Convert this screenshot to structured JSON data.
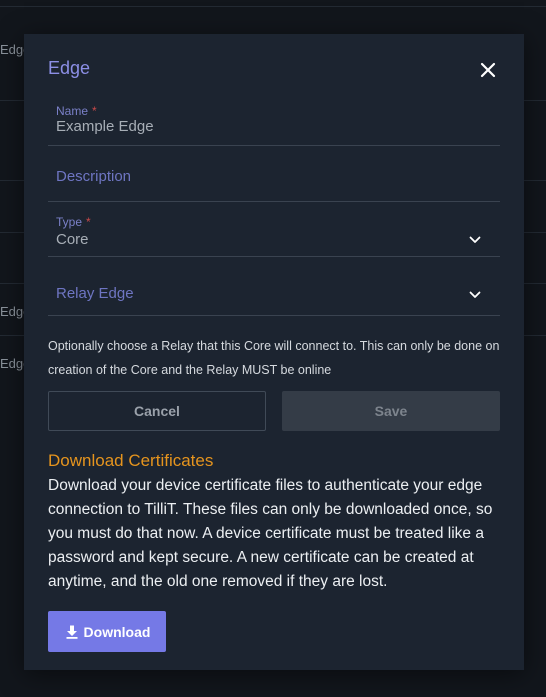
{
  "background": {
    "row_labels": [
      "Edge",
      "Edge",
      "Edge"
    ]
  },
  "modal": {
    "title": "Edge",
    "close_icon": "close-icon",
    "name_field": {
      "label": "Name",
      "required_mark": "*",
      "value": "Example Edge"
    },
    "description_field": {
      "placeholder": "Description"
    },
    "type_field": {
      "label": "Type",
      "required_mark": "*",
      "value": "Core",
      "icon": "chevron-down-icon"
    },
    "relay_field": {
      "placeholder": "Relay Edge",
      "icon": "chevron-down-icon"
    },
    "helper_text": "Optionally choose a Relay that this Core will connect to. This can only be done on creation of the Core and the Relay MUST be online",
    "cancel_label": "Cancel",
    "save_label": "Save",
    "certificates": {
      "title": "Download Certificates",
      "body": "Download your device certificate files to authenticate your edge connection to TilliT. These files can only be downloaded once, so you must do that now. A device certificate must be treated like a password and kept secure. A new certificate can be created at anytime, and the old one removed if they are lost.",
      "download_label": "Download",
      "download_icon": "download-icon"
    }
  },
  "colors": {
    "accent": "#8c8fe6",
    "download_button": "#7579e6",
    "section_title": "#e5941e",
    "required": "#c94a4a"
  }
}
